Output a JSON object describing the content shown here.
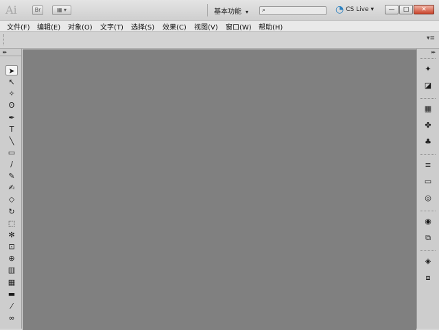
{
  "app": {
    "logo": "Ai",
    "bridge_label": "Br",
    "arrange_label": "▦",
    "workspace": "基本功能",
    "cslive": "CS Live"
  },
  "window_controls": {
    "minimize": "—",
    "maximize": "□",
    "close": "✕"
  },
  "menu": [
    "文件(F)",
    "编辑(E)",
    "对象(O)",
    "文字(T)",
    "选择(S)",
    "效果(C)",
    "视图(V)",
    "窗口(W)",
    "帮助(H)"
  ],
  "icons": {
    "search": "⌕",
    "caret": "▾",
    "collapse": "▸▸",
    "panel_menu": "▾≡"
  },
  "tools": [
    {
      "name": "selection-tool",
      "glyph": "➤"
    },
    {
      "name": "direct-selection-tool",
      "glyph": "↖"
    },
    {
      "name": "magic-wand-tool",
      "glyph": "✧"
    },
    {
      "name": "lasso-tool",
      "glyph": "ʘ"
    },
    {
      "name": "pen-tool",
      "glyph": "✒"
    },
    {
      "name": "type-tool",
      "glyph": "T"
    },
    {
      "name": "line-segment-tool",
      "glyph": "╲"
    },
    {
      "name": "rectangle-tool",
      "glyph": "▭"
    },
    {
      "name": "paintbrush-tool",
      "glyph": "/"
    },
    {
      "name": "pencil-tool",
      "glyph": "✎"
    },
    {
      "name": "blob-brush-tool",
      "glyph": "✍"
    },
    {
      "name": "eraser-tool",
      "glyph": "◇"
    },
    {
      "name": "rotate-tool",
      "glyph": "↻"
    },
    {
      "name": "scale-tool",
      "glyph": "⬚"
    },
    {
      "name": "warp-tool",
      "glyph": "✻"
    },
    {
      "name": "free-transform-tool",
      "glyph": "⊡"
    },
    {
      "name": "shape-builder-tool",
      "glyph": "⊕"
    },
    {
      "name": "perspective-grid-tool",
      "glyph": "▥"
    },
    {
      "name": "mesh-tool",
      "glyph": "▦"
    },
    {
      "name": "gradient-tool",
      "glyph": "▬"
    },
    {
      "name": "eyedropper-tool",
      "glyph": "⁄"
    },
    {
      "name": "blend-tool",
      "glyph": "∞"
    }
  ],
  "dock": [
    {
      "name": "color-panel",
      "glyph": "✦"
    },
    {
      "name": "color-guide-panel",
      "glyph": "◪"
    },
    {
      "name": "swatches-panel",
      "glyph": "▦"
    },
    {
      "name": "brushes-panel",
      "glyph": "✤"
    },
    {
      "name": "symbols-panel",
      "glyph": "♣"
    },
    {
      "name": "stroke-panel",
      "glyph": "≡"
    },
    {
      "name": "gradient-panel",
      "glyph": "▭"
    },
    {
      "name": "transparency-panel",
      "glyph": "◎"
    },
    {
      "name": "appearance-panel",
      "glyph": "◉"
    },
    {
      "name": "graphic-styles-panel",
      "glyph": "⧉"
    },
    {
      "name": "layers-panel",
      "glyph": "◈"
    },
    {
      "name": "artboards-panel",
      "glyph": "⧈"
    }
  ]
}
